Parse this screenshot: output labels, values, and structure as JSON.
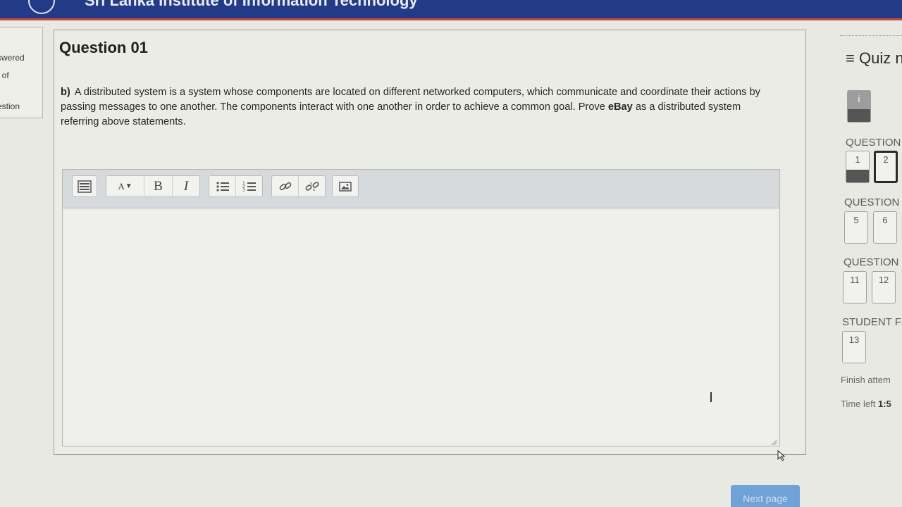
{
  "header": {
    "title": "Sri Lanka Institute of Information Technology"
  },
  "left_block": {
    "line1": "swered",
    "line2": "t of",
    "line3": "estion"
  },
  "question": {
    "title": "Question 01",
    "lead": "b)",
    "text_part1": "A distributed system is a system whose components are located on different networked computers, which communicate and coordinate their actions by passing messages to one another. The components interact with one another in order to achieve a common goal. Prove ",
    "brand": "eBay",
    "text_part2": " as a distributed system referring above statements."
  },
  "editor": {
    "font_size_label": "A",
    "bold_label": "B",
    "italic_label": "I",
    "content": ""
  },
  "quiz_nav": {
    "title": "Quiz n",
    "info_label": "i",
    "section1_label": "QUESTION",
    "section2_label": "QUESTION",
    "section3_label": "QUESTION",
    "section4_label": "STUDENT F",
    "q1": "1",
    "q2": "2",
    "q5": "5",
    "q6": "6",
    "q11": "11",
    "q12": "12",
    "q13": "13",
    "finish_link": "Finish attem",
    "time_left_label": "Time left",
    "time_left_value": "1:5"
  },
  "footer": {
    "next_button": "Next page"
  }
}
